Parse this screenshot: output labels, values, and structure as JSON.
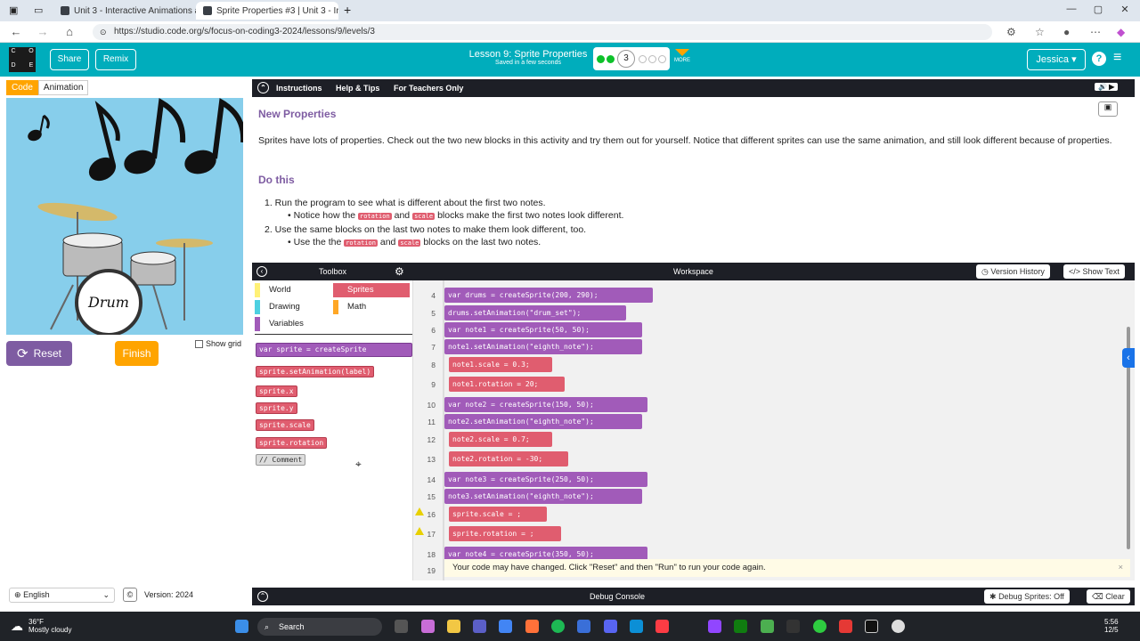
{
  "browser": {
    "tabs": [
      {
        "title": "Unit 3 - Interactive Animations an",
        "active": false
      },
      {
        "title": "Sprite Properties #3 | Unit 3 - Inte",
        "active": true
      }
    ],
    "new_tab": "+",
    "url": "https://studio.code.org/s/focus-on-coding3-2024/lessons/9/levels/3"
  },
  "header": {
    "logo_letters": [
      "C",
      "O",
      "D",
      "E"
    ],
    "share_label": "Share",
    "remix_label": "Remix",
    "lesson_title": "Lesson 9: Sprite Properties",
    "saved_status": "Saved in a few seconds",
    "current_level": "3",
    "more_label": "MORE",
    "user_name": "Jessica",
    "help_label": "?"
  },
  "left": {
    "code_tab": "Code",
    "animation_tab": "Animation",
    "reset_label": "Reset",
    "finish_label": "Finish",
    "show_grid_label": "Show grid",
    "language": "English",
    "version": "Version: 2024",
    "drum_text": "Drum"
  },
  "instructions": {
    "tabs": [
      "Instructions",
      "Help & Tips",
      "For Teachers Only"
    ],
    "heading1": "New Properties",
    "paragraph": "Sprites have lots of properties. Check out the two new blocks in this activity and try them out for yourself. Notice that different sprites can use the same animation, and still look different because of properties.",
    "heading2": "Do this",
    "step1": "1. Run the program to see what is different about the first two notes.",
    "step1_sub_a": "• Notice how the",
    "step1_sub_b": "and",
    "step1_sub_c": "blocks make the first two notes look different.",
    "step2": "2. Use the same blocks on the last two notes to make them look different, too.",
    "step2_sub_a": "• Use the the",
    "step2_sub_b": "and",
    "step2_sub_c": "blocks on the last two notes.",
    "block_rotation": "rotation",
    "block_scale": "scale"
  },
  "toolbox": {
    "title": "Toolbox",
    "categories": [
      {
        "label": "World",
        "color": "#fff176"
      },
      {
        "label": "Sprites",
        "color": "#e05d6f"
      },
      {
        "label": "Drawing",
        "color": "#4dd0e1"
      },
      {
        "label": "Math",
        "color": "#ffa726"
      },
      {
        "label": "Variables",
        "color": "#a15bb9"
      }
    ],
    "blocks": [
      "var sprite = createSprite",
      "sprite.setAnimation(label)",
      "sprite.x",
      "sprite.y",
      "sprite.scale",
      "sprite.rotation",
      "// Comment"
    ]
  },
  "workspace": {
    "title": "Workspace",
    "version_history": "Version History",
    "show_text": "Show Text",
    "lines": [
      {
        "n": "4",
        "code": "var drums = createSprite(200, 290);"
      },
      {
        "n": "5",
        "code": "drums.setAnimation(\"drum_set\");"
      },
      {
        "n": "6",
        "code": "var note1 = createSprite(50, 50);"
      },
      {
        "n": "7",
        "code": "note1.setAnimation(\"eighth_note\");"
      },
      {
        "n": "8",
        "code": "note1.scale = 0.3;"
      },
      {
        "n": "9",
        "code": "note1.rotation = 20;"
      },
      {
        "n": "10",
        "code": "var note2 = createSprite(150, 50);"
      },
      {
        "n": "11",
        "code": "note2.setAnimation(\"eighth_note\");"
      },
      {
        "n": "12",
        "code": "note2.scale = 0.7;"
      },
      {
        "n": "13",
        "code": "note2.rotation = -30;"
      },
      {
        "n": "14",
        "code": "var note3 = createSprite(250, 50);"
      },
      {
        "n": "15",
        "code": "note3.setAnimation(\"eighth_note\");"
      },
      {
        "n": "16",
        "code": "sprite.scale = ;"
      },
      {
        "n": "17",
        "code": "sprite.rotation = ;"
      },
      {
        "n": "18",
        "code": "var note4 = createSprite(350, 50);"
      },
      {
        "n": "19",
        "code": ""
      }
    ],
    "notice": "Your code may have changed. Click \"Reset\" and then \"Run\" to run your code again.",
    "notice_close": "×"
  },
  "debug": {
    "title": "Debug Console",
    "sprites_btn": "Debug Sprites: Off",
    "clear_btn": "Clear"
  },
  "taskbar": {
    "temp": "36°F",
    "weather": "Mostly cloudy",
    "search": "Search",
    "time": "5:56",
    "date": "12/5"
  }
}
